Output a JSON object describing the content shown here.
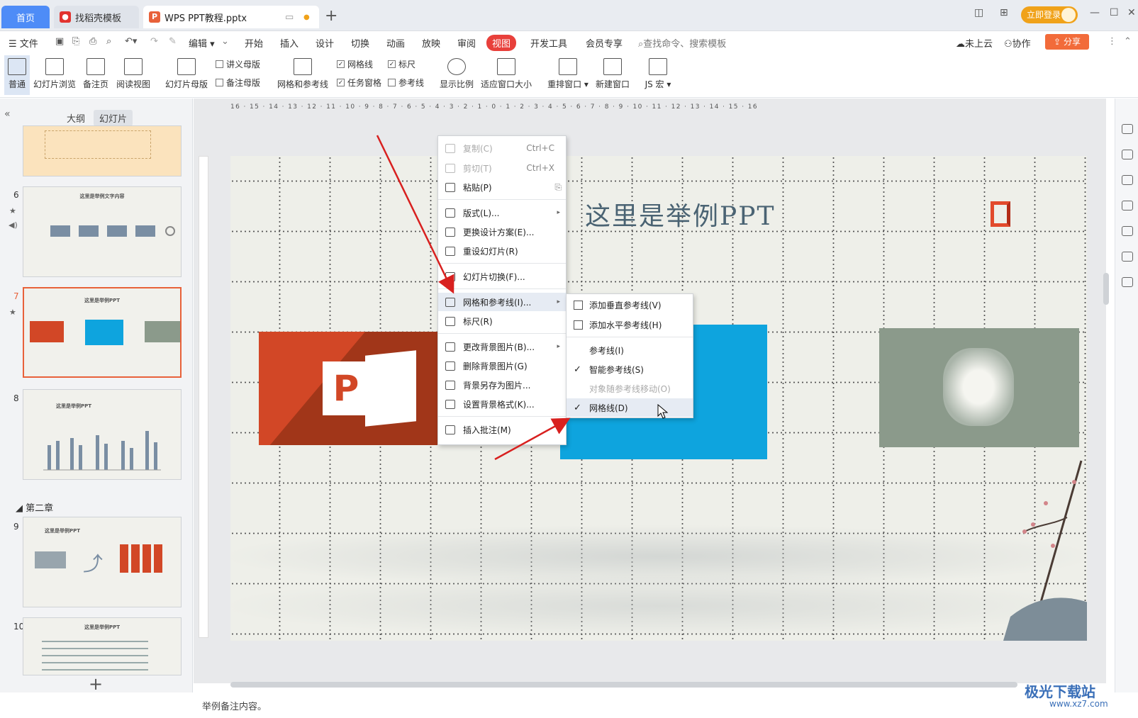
{
  "tabs": {
    "home": "首页",
    "template": "找稻壳模板",
    "document": "WPS PPT教程.pptx"
  },
  "titlebar": {
    "login": "立即登录"
  },
  "menu": {
    "file": "文件",
    "edit": "编辑",
    "items": [
      "开始",
      "插入",
      "设计",
      "切换",
      "动画",
      "放映",
      "审阅",
      "视图",
      "开发工具",
      "会员专享"
    ],
    "search_placeholder": "查找命令、搜索模板",
    "cloud": "未上云",
    "collab": "协作",
    "share": "分享"
  },
  "ribbon": {
    "normal": "普通",
    "slide_browse": "幻灯片浏览",
    "notes_page": "备注页",
    "reading_view": "阅读视图",
    "slide_master": "幻灯片母版",
    "handout_master": "讲义母版",
    "notes_master": "备注母版",
    "grid_guides": "网格和参考线",
    "gridlines": "网格线",
    "ruler": "标尺",
    "task_pane": "任务窗格",
    "guides": "参考线",
    "zoom": "显示比例",
    "fit_window": "适应窗口大小",
    "arrange": "重排窗口",
    "new_window": "新建窗口",
    "macro": "JS 宏"
  },
  "leftpanel": {
    "outline_tab": "大纲",
    "slides_tab": "幻灯片",
    "chapter": "第二章",
    "slide_numbers": [
      "6",
      "7",
      "8",
      "9",
      "10"
    ],
    "thumb_title": "这里是举例PPT",
    "thumb6_title": "这里是举例文字内容"
  },
  "ruler": {
    "h_labels": "16 · 15 · 14 · 13 · 12 · 11 · 10 · 9 · 8 · 7 · 6 · 5 · 4 · 3 · 2 · 1 · 0 · 1 · 2 · 3 · 4 · 5 · 6 · 7 · 8 · 9 · 10 · 11 · 12 · 13 · 14 · 15 · 16"
  },
  "slide": {
    "title": "这里是举例PPT"
  },
  "context_menu": {
    "copy": "复制(C)",
    "copy_shortcut": "Ctrl+C",
    "cut": "剪切(T)",
    "cut_shortcut": "Ctrl+X",
    "paste": "粘贴(P)",
    "layout": "版式(L)...",
    "change_design": "更换设计方案(E)...",
    "reset_slide": "重设幻灯片(R)",
    "slide_transition": "幻灯片切换(F)...",
    "grid_guides": "网格和参考线(I)...",
    "ruler": "标尺(R)",
    "change_bg": "更改背景图片(B)...",
    "delete_bg": "删除背景图片(G)",
    "save_bg": "背景另存为图片...",
    "bg_format": "设置背景格式(K)...",
    "insert_comment": "插入批注(M)"
  },
  "submenu": {
    "add_vertical": "添加垂直参考线(V)",
    "add_horizontal": "添加水平参考线(H)",
    "guides": "参考线(I)",
    "smart_guides": "智能参考线(S)",
    "move_with_object": "对象随参考线移动(O)",
    "gridlines": "网格线(D)"
  },
  "notes": {
    "text": "举例备注内容。"
  },
  "watermark": {
    "text": "极光下载站",
    "url": "www.xz7.com"
  },
  "colors": {
    "accent": "#e8403b",
    "home_tab": "#4e8cf7",
    "ppt_orange": "#d24726",
    "blue_box": "#0ea4de",
    "arrow": "#d8201f"
  }
}
